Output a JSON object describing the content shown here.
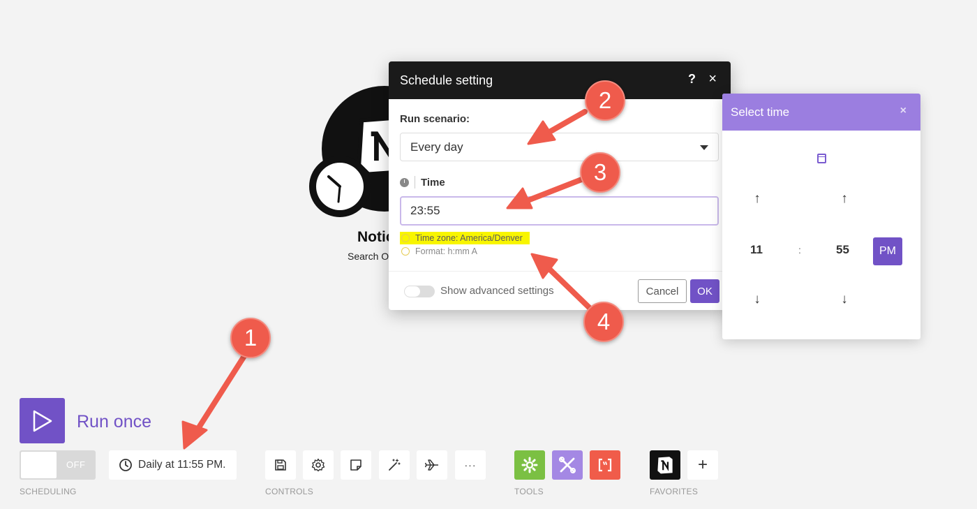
{
  "module": {
    "name": "Notic",
    "subtitle": "Search O"
  },
  "dialog": {
    "title": "Schedule setting",
    "help": "?",
    "close": "×",
    "run_label": "Run scenario:",
    "run_value": "Every day",
    "time_label": "Time",
    "time_value": "23:55",
    "timezone_hint": "Time zone: America/Denver",
    "format_hint": "Format: h:mm A",
    "advanced_label": "Show advanced settings",
    "cancel": "Cancel",
    "ok": "OK"
  },
  "timepanel": {
    "title": "Select time",
    "close": "×",
    "hour": "11",
    "colon": ":",
    "minute": "55",
    "ampm": "PM"
  },
  "bottom": {
    "run_once": "Run once",
    "toggle_state": "OFF",
    "schedule_text": "Daily at 11:55 PM.",
    "scheduling_label": "SCHEDULING",
    "controls_label": "CONTROLS",
    "tools_label": "TOOLS",
    "favorites_label": "FAVORITES",
    "more": "···",
    "add": "+"
  },
  "annotations": [
    "1",
    "2",
    "3",
    "4"
  ],
  "colors": {
    "accent": "#7152c6",
    "panel_header": "#9b7ee0",
    "badge": "#ef5b4c",
    "highlight": "#f8f500",
    "tool_green": "#7bc043",
    "tool_purple": "#a488e4",
    "tool_red": "#f05c4a"
  }
}
